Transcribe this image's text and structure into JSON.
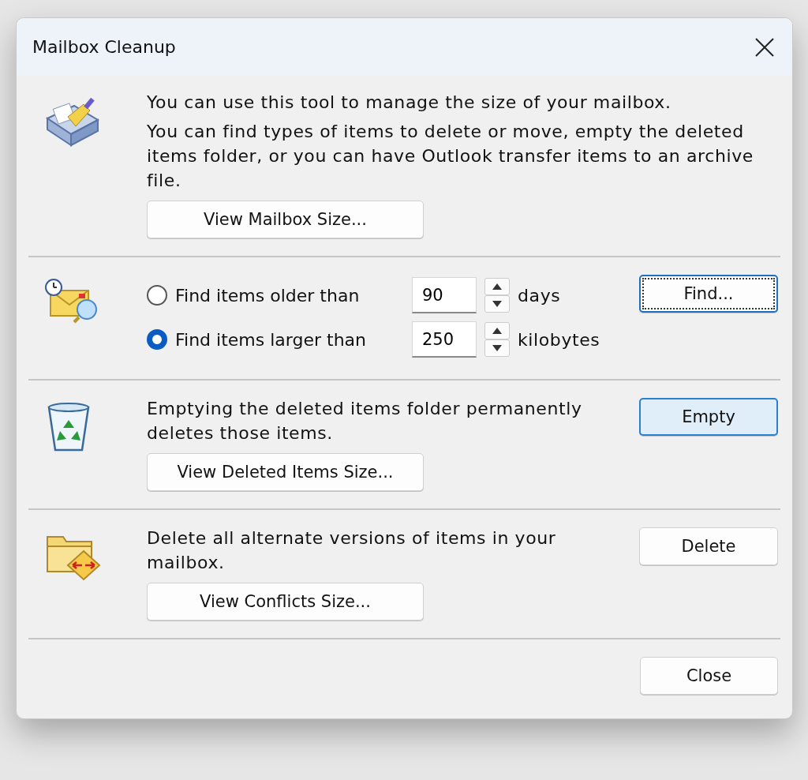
{
  "window": {
    "title": "Mailbox Cleanup"
  },
  "sections": [
    {
      "kind": "mailbox",
      "paragraphs": [
        "You can use this tool to manage the size of your mailbox.",
        "You can find types of items to delete or move, empty the deleted items folder, or you can have Outlook transfer items to an archive file."
      ],
      "left_button": {
        "label": "View Mailbox Size...",
        "kind": "normal"
      }
    },
    {
      "kind": "find",
      "options": [
        {
          "label": "Find items older than",
          "selected": false,
          "value": "90",
          "unit": "days"
        },
        {
          "label": "Find items larger than",
          "selected": true,
          "value": "250",
          "unit": "kilobytes"
        }
      ],
      "right_button": {
        "label": "Find...",
        "kind": "focused"
      }
    },
    {
      "kind": "deleted",
      "paragraphs": [
        "Emptying the deleted items folder permanently deletes those items."
      ],
      "left_button": {
        "label": "View Deleted Items Size...",
        "kind": "normal"
      },
      "right_button": {
        "label": "Empty",
        "kind": "default"
      }
    },
    {
      "kind": "conflicts",
      "paragraphs": [
        "Delete all alternate versions of items in your mailbox."
      ],
      "left_button": {
        "label": "View Conflicts Size...",
        "kind": "normal"
      },
      "right_button": {
        "label": "Delete",
        "kind": "normal"
      }
    }
  ],
  "footer": {
    "button": {
      "label": "Close",
      "kind": "normal"
    }
  }
}
